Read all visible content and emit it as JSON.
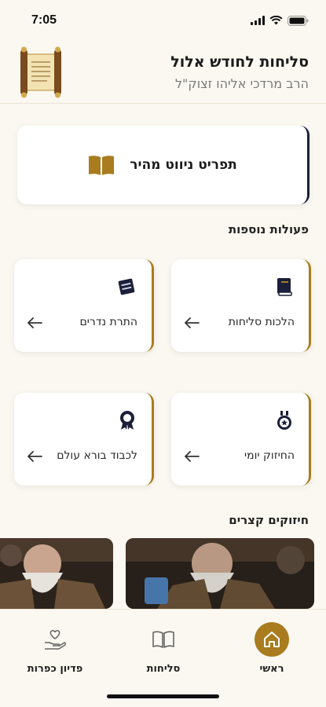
{
  "status_bar": {
    "time": "7:05"
  },
  "header": {
    "title": "סליחות לחודש אלול",
    "subtitle": "הרב מרדכי אליהו זצוק\"ל",
    "logo_icon": "torah-scroll-icon"
  },
  "quick_nav": {
    "label": "תפריט ניווט מהיר",
    "icon": "open-book-icon"
  },
  "more_actions": {
    "title": "פעולות נוספות",
    "items": [
      {
        "label": "הלכות סליחות",
        "icon": "closed-book-icon"
      },
      {
        "label": "התרת נדרים",
        "icon": "books-icon"
      },
      {
        "label": "החיזוק יומי",
        "icon": "medal-icon"
      },
      {
        "label": "לכבוד בורא עולם",
        "icon": "award-ribbon-icon"
      }
    ]
  },
  "shorts": {
    "title": "חיזוקים קצרים"
  },
  "tabs": [
    {
      "label": "ראשי",
      "icon": "home-icon",
      "active": true
    },
    {
      "label": "סליחות",
      "icon": "open-book-outline-icon",
      "active": false
    },
    {
      "label": "פדיון כפרות",
      "icon": "heart-hand-icon",
      "active": false
    }
  ],
  "colors": {
    "accent": "#a97c1f",
    "background": "#fbf8f1",
    "dark_border": "#1b1f3a"
  }
}
